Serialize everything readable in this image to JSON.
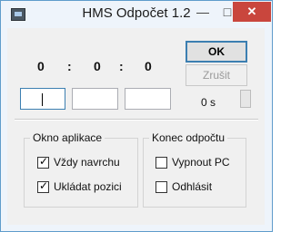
{
  "window": {
    "title": "HMS Odpočet 1.2"
  },
  "titlebar": {
    "minimize": "—",
    "maximize": "□",
    "close": "✕"
  },
  "time": {
    "hours": "0",
    "sep1": ":",
    "minutes": "0",
    "sep2": ":",
    "seconds": "0"
  },
  "inputs": {
    "hours": "",
    "minutes": "",
    "seconds": ""
  },
  "buttons": {
    "ok": "OK",
    "cancel": "Zrušit"
  },
  "countdown": {
    "remaining": "0 s"
  },
  "groups": {
    "app_window": {
      "title": "Okno aplikace",
      "items": [
        {
          "label": "Vždy navrchu",
          "checked": true
        },
        {
          "label": "Ukládat pozici",
          "checked": true
        }
      ]
    },
    "end_countdown": {
      "title": "Konec odpočtu",
      "items": [
        {
          "label": "Vypnout PC",
          "checked": false
        },
        {
          "label": "Odhlásit",
          "checked": false
        }
      ]
    }
  }
}
